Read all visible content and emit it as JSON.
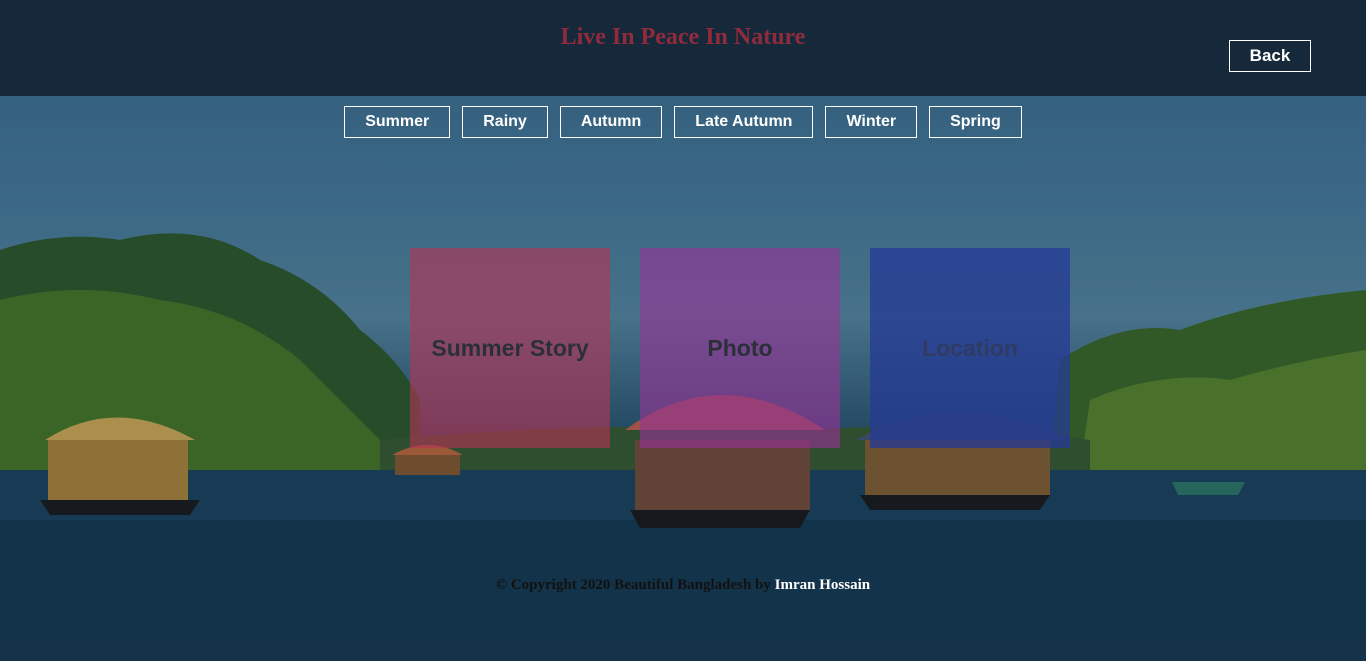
{
  "header": {
    "title": "Live In Peace In Nature",
    "back_label": "Back"
  },
  "seasons": [
    {
      "label": "Summer"
    },
    {
      "label": "Rainy"
    },
    {
      "label": "Autumn"
    },
    {
      "label": "Late Autumn"
    },
    {
      "label": "Winter"
    },
    {
      "label": "Spring"
    }
  ],
  "cards": {
    "story": "Summer Story",
    "photo": "Photo",
    "location": "Location"
  },
  "footer": {
    "copyright": "© Copyright 2020 Beautiful Bangladesh by",
    "author": "Imran Hossain"
  },
  "colors": {
    "header_bg": "#15293a",
    "title": "#8f2b3c",
    "story_card": "#b53454",
    "photo_card": "#963496",
    "location_card": "#243a96"
  }
}
